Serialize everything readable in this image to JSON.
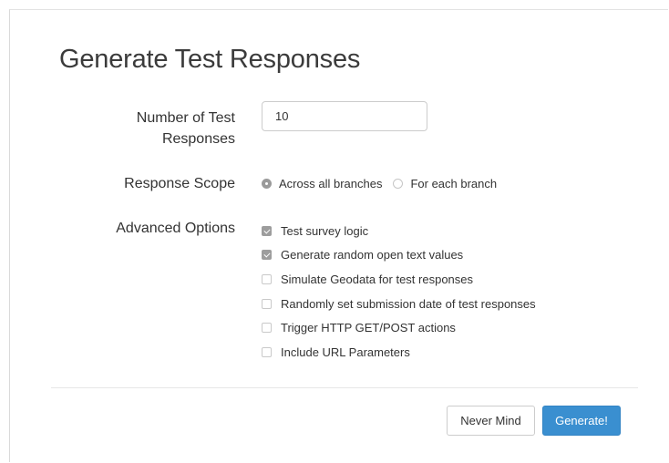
{
  "dialog": {
    "title": "Generate Test Responses"
  },
  "form": {
    "num_responses": {
      "label": "Number of Test Responses",
      "value": "10"
    },
    "response_scope": {
      "label": "Response Scope",
      "options": [
        {
          "label": "Across all branches",
          "selected": true
        },
        {
          "label": "For each branch",
          "selected": false
        }
      ]
    },
    "advanced_options": {
      "label": "Advanced Options",
      "items": [
        {
          "label": "Test survey logic",
          "checked": true
        },
        {
          "label": "Generate random open text values",
          "checked": true
        },
        {
          "label": "Simulate Geodata for test responses",
          "checked": false
        },
        {
          "label": "Randomly set submission date of test responses",
          "checked": false
        },
        {
          "label": "Trigger HTTP GET/POST actions",
          "checked": false
        },
        {
          "label": "Include URL Parameters",
          "checked": false
        }
      ]
    }
  },
  "footer": {
    "cancel_label": "Never Mind",
    "submit_label": "Generate!"
  },
  "colors": {
    "primary_button": "#3a8fd0",
    "checked_control": "#9d9d9d"
  }
}
